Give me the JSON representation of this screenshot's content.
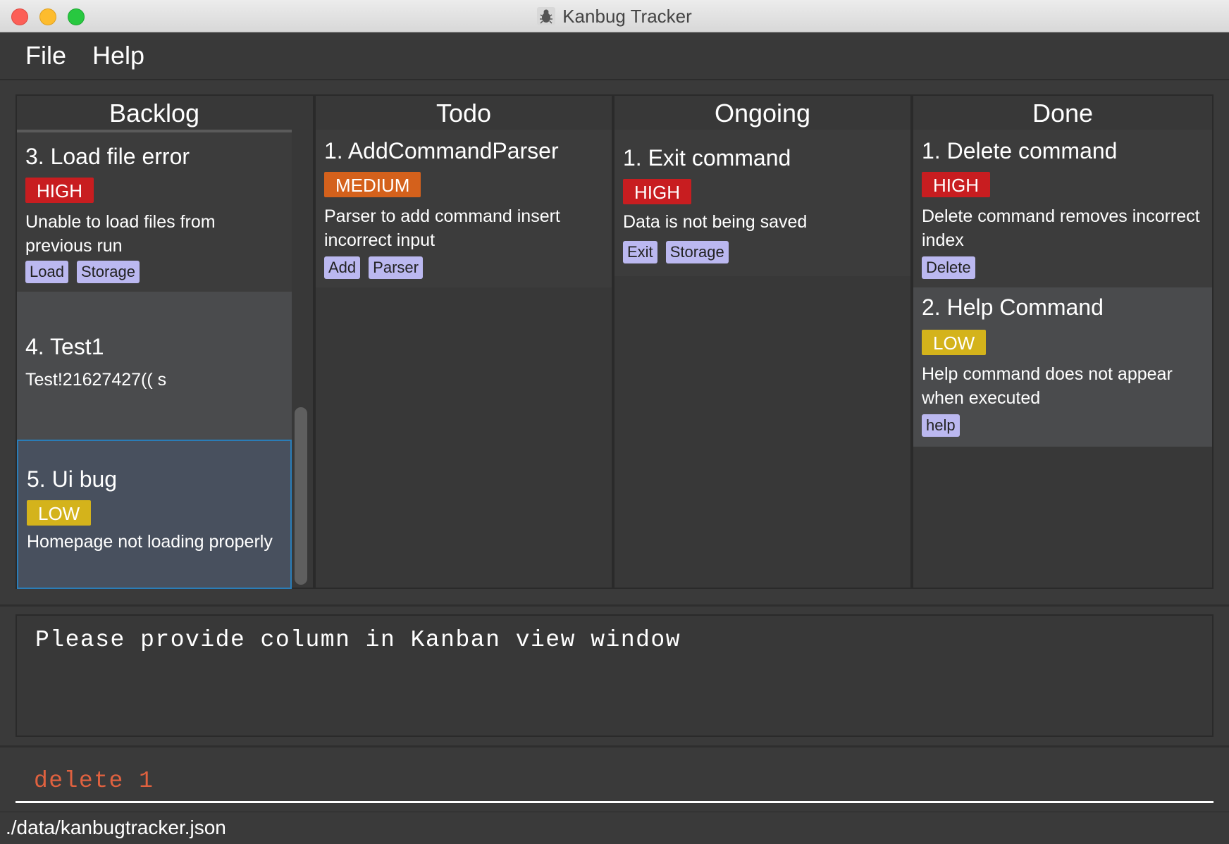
{
  "window": {
    "title": "Kanbug Tracker"
  },
  "menu": {
    "file": "File",
    "help": "Help"
  },
  "columns": [
    {
      "name": "Backlog",
      "cards": [
        {
          "title": "3. Load file error",
          "priority": "HIGH",
          "description": "Unable to load files from previous run",
          "tags": [
            "Load",
            "Storage"
          ]
        },
        {
          "title": "4. Test1",
          "priority": "",
          "description": "Test!21627427(( s",
          "tags": []
        },
        {
          "title": "5. Ui bug",
          "priority": "LOW",
          "description": "Homepage not loading properly",
          "tags": []
        }
      ]
    },
    {
      "name": "Todo",
      "cards": [
        {
          "title": "1. AddCommandParser",
          "priority": "MEDIUM",
          "description": "Parser to add command insert incorrect input",
          "tags": [
            "Add",
            "Parser"
          ]
        }
      ]
    },
    {
      "name": "Ongoing",
      "cards": [
        {
          "title": "1. Exit command",
          "priority": "HIGH",
          "description": "Data is not being saved",
          "tags": [
            "Exit",
            "Storage"
          ]
        }
      ]
    },
    {
      "name": "Done",
      "cards": [
        {
          "title": "1. Delete command",
          "priority": "HIGH",
          "description": "Delete command removes incorrect index",
          "tags": [
            "Delete"
          ]
        },
        {
          "title": "2. Help Command",
          "priority": "LOW",
          "description": "Help command does not appear when executed",
          "tags": [
            "help"
          ]
        }
      ]
    }
  ],
  "result": {
    "text": "Please provide column in Kanban view window"
  },
  "command": {
    "value": "delete 1"
  },
  "status": {
    "path": "./data/kanbugtracker.json"
  },
  "colors": {
    "high": "#c81d20",
    "medium": "#d4611c",
    "low": "#d4b31b",
    "tag": "#bbb8f0",
    "selection": "#2a7db8"
  }
}
